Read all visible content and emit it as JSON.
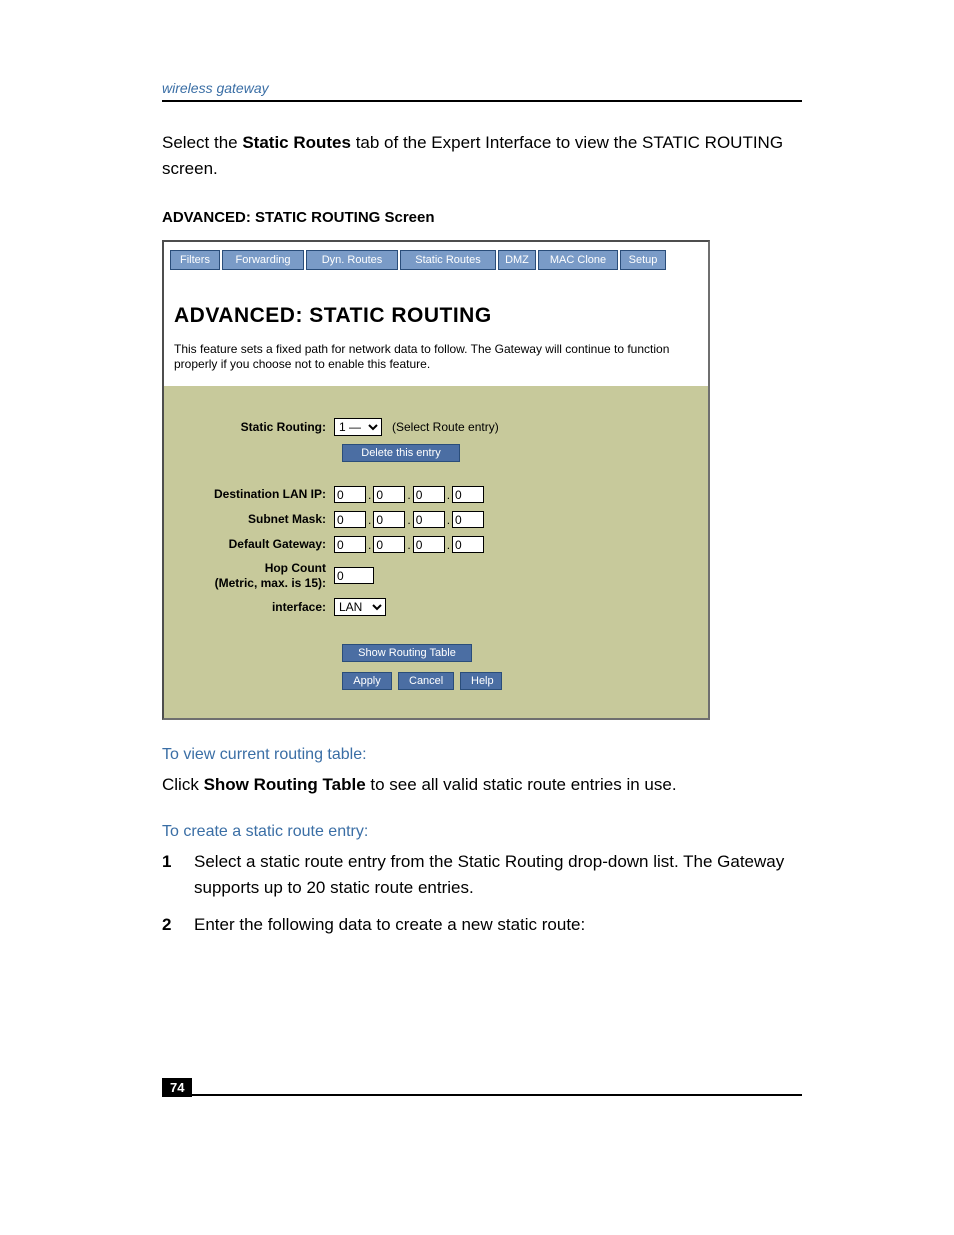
{
  "header": {
    "running": "wireless gateway"
  },
  "intro": {
    "pre": "Select the ",
    "bold": "Static Routes",
    "post": " tab of the Expert Interface to view the STATIC ROUTING screen."
  },
  "caption": "ADVANCED: STATIC ROUTING Screen",
  "screenshot": {
    "tabs": [
      "Filters",
      "Forwarding",
      "Dyn. Routes",
      "Static Routes",
      "DMZ",
      "MAC Clone",
      "Setup"
    ],
    "tab_widths": [
      50,
      82,
      92,
      96,
      38,
      80,
      46
    ],
    "title": "ADVANCED: STATIC ROUTING",
    "desc": "This feature sets a fixed path for network data to follow. The Gateway will continue to function properly if you choose not to enable this feature.",
    "labels": {
      "static_routing": "Static Routing:",
      "route_entry_hint": "(Select Route entry)",
      "route_select_value": "1 —",
      "delete_btn": "Delete this entry",
      "dest_ip": "Destination LAN IP:",
      "subnet": "Subnet Mask:",
      "gateway": "Default Gateway:",
      "hop1": "Hop Count",
      "hop2": "(Metric, max. is 15):",
      "interface": "interface:",
      "interface_value": "LAN",
      "show_table": "Show Routing Table",
      "apply": "Apply",
      "cancel": "Cancel",
      "help": "Help"
    },
    "ip": {
      "dest": [
        "0",
        "0",
        "0",
        "0"
      ],
      "subnet": [
        "0",
        "0",
        "0",
        "0"
      ],
      "gw": [
        "0",
        "0",
        "0",
        "0"
      ],
      "hop": "0"
    }
  },
  "sec1": {
    "heading": "To view current routing table:",
    "pre": "Click ",
    "bold": "Show Routing Table",
    "post": " to see all valid static route entries in use."
  },
  "sec2": {
    "heading": "To create a static route entry:",
    "steps": [
      "Select a static route entry from the Static Routing drop-down list. The Gateway supports up to 20 static route entries.",
      "Enter the following data to create a new static route:"
    ]
  },
  "footer": {
    "page": "74"
  }
}
